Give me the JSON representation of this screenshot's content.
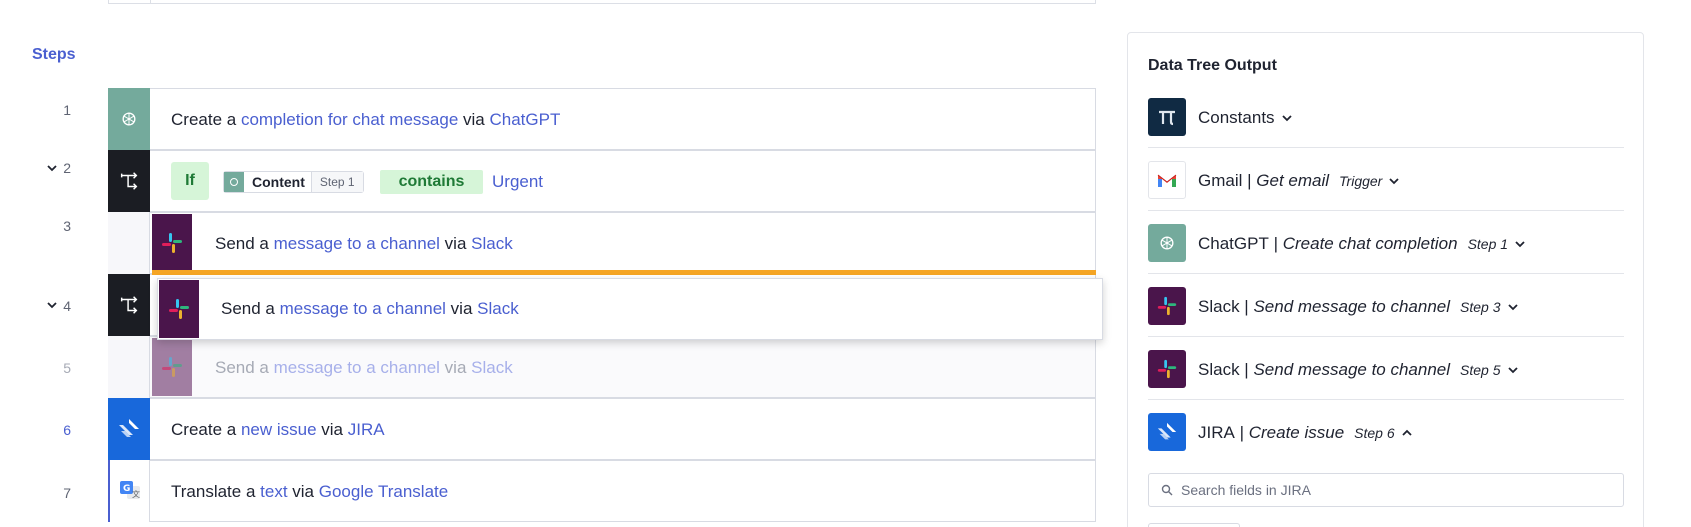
{
  "steps_title": "Steps",
  "steps": [
    {
      "num": "1",
      "prefix": "Create a ",
      "action": "completion for chat message",
      "via": " via ",
      "app": "ChatGPT",
      "icon": "openai-icon"
    },
    {
      "num": "2",
      "condition": {
        "if": "If",
        "field": "Content",
        "field_step": "Step 1",
        "operator": "contains",
        "value": "Urgent"
      },
      "icon": "branch-icon"
    },
    {
      "num": "3",
      "prefix": "Send a ",
      "action": "message to a channel",
      "via": " via ",
      "app": "Slack",
      "icon": "slack-icon"
    },
    {
      "num": "4",
      "icon": "branch-icon"
    },
    {
      "num": "5",
      "prefix": "Send a ",
      "action": "message to a channel",
      "via": " via ",
      "app": "Slack",
      "icon": "slack-icon"
    },
    {
      "num": "6",
      "prefix": "Create a ",
      "action": "new issue",
      "via": " via ",
      "app": "JIRA",
      "icon": "jira-icon"
    },
    {
      "num": "7",
      "prefix": "Translate a ",
      "action": "text",
      "via": " via ",
      "app": "Google Translate",
      "icon": "google-translate-icon"
    }
  ],
  "drag_card": {
    "prefix": "Send a ",
    "action": "message to a channel",
    "via": " via ",
    "app": "Slack"
  },
  "colors": {
    "accent": "#4a5fd0",
    "drop_indicator": "#f5a524",
    "slack_bg": "#4a154b",
    "openai_bg": "#74aa9c",
    "jira_bg": "#1868db",
    "condition_bg": "#d6f5d8"
  },
  "panel": {
    "title": "Data Tree Output",
    "items": [
      {
        "app": "Constants",
        "sep": "",
        "action": "",
        "step": "",
        "caret": "down",
        "icon": "pi-icon"
      },
      {
        "app": "Gmail",
        "sep": " | ",
        "action": "Get email",
        "step": "Trigger",
        "caret": "down",
        "icon": "gmail-icon"
      },
      {
        "app": "ChatGPT",
        "sep": " | ",
        "action": "Create chat completion",
        "step": "Step 1",
        "caret": "down",
        "icon": "openai-icon"
      },
      {
        "app": "Slack",
        "sep": " | ",
        "action": "Send message to channel",
        "step": "Step 3",
        "caret": "down",
        "icon": "slack-icon"
      },
      {
        "app": "Slack",
        "sep": " | ",
        "action": "Send message to channel",
        "step": "Step 5",
        "caret": "down",
        "icon": "slack-icon"
      },
      {
        "app": "JIRA",
        "sep": " | ",
        "action": "Create issue",
        "step": "Step 6",
        "caret": "up",
        "icon": "jira-icon"
      }
    ],
    "search_placeholder": "Search fields in JIRA"
  }
}
